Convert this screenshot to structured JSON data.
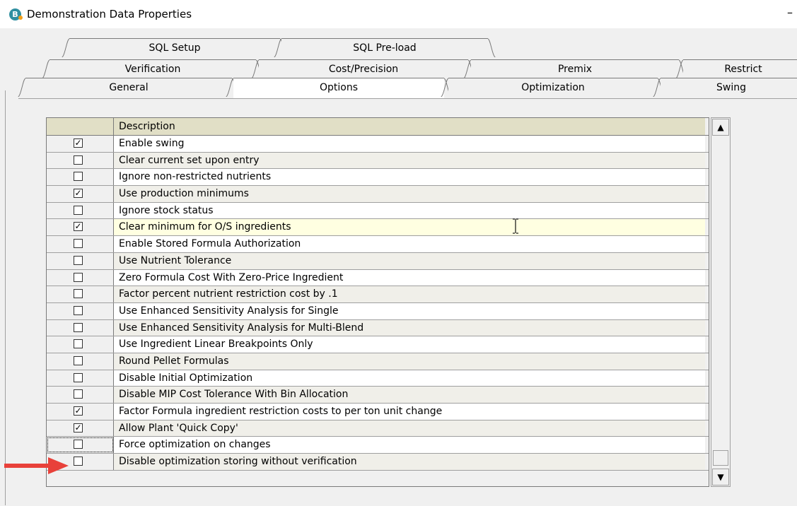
{
  "window": {
    "title": "Demonstration Data Properties",
    "icon_letter": "B",
    "minimize_glyph": "–"
  },
  "tabs": {
    "row1": [
      {
        "label": "SQL Setup"
      },
      {
        "label": "SQL Pre-load"
      }
    ],
    "row2": [
      {
        "label": "Verification"
      },
      {
        "label": "Cost/Precision"
      },
      {
        "label": "Premix"
      },
      {
        "label": "Restrict"
      }
    ],
    "row3": [
      {
        "label": "General"
      },
      {
        "label": "Options",
        "active": true
      },
      {
        "label": "Optimization"
      },
      {
        "label": "Swing"
      }
    ]
  },
  "grid": {
    "header": "Description",
    "rows": [
      {
        "checked": true,
        "label": "Enable swing"
      },
      {
        "checked": false,
        "label": "Clear current set upon entry"
      },
      {
        "checked": false,
        "label": "Ignore non-restricted nutrients"
      },
      {
        "checked": true,
        "label": "Use production minimums"
      },
      {
        "checked": false,
        "label": "Ignore stock status"
      },
      {
        "checked": true,
        "label": "Clear minimum for O/S ingredients",
        "highlight": true
      },
      {
        "checked": false,
        "label": "Enable Stored Formula Authorization"
      },
      {
        "checked": false,
        "label": "Use Nutrient Tolerance"
      },
      {
        "checked": false,
        "label": "Zero Formula Cost With Zero-Price Ingredient"
      },
      {
        "checked": false,
        "label": "Factor percent nutrient restriction cost by .1"
      },
      {
        "checked": false,
        "label": "Use Enhanced Sensitivity Analysis for Single"
      },
      {
        "checked": false,
        "label": "Use Enhanced Sensitivity Analysis for Multi-Blend"
      },
      {
        "checked": false,
        "label": "Use Ingredient Linear Breakpoints Only"
      },
      {
        "checked": false,
        "label": "Round Pellet Formulas"
      },
      {
        "checked": false,
        "label": "Disable Initial Optimization"
      },
      {
        "checked": false,
        "label": "Disable MIP Cost Tolerance With Bin Allocation"
      },
      {
        "checked": true,
        "label": "Factor Formula ingredient restriction costs to per ton unit change"
      },
      {
        "checked": true,
        "label": "Allow Plant 'Quick Copy'"
      },
      {
        "checked": false,
        "label": "Force optimization on changes",
        "focus": true
      },
      {
        "checked": false,
        "label": "Disable optimization storing without verification"
      }
    ]
  },
  "scrollbar": {
    "up_glyph": "▲",
    "down_glyph": "▼"
  },
  "colors": {
    "header_bg": "#e1dfc6",
    "highlight_row": "#ffffe1",
    "arrow": "#e8413a"
  }
}
